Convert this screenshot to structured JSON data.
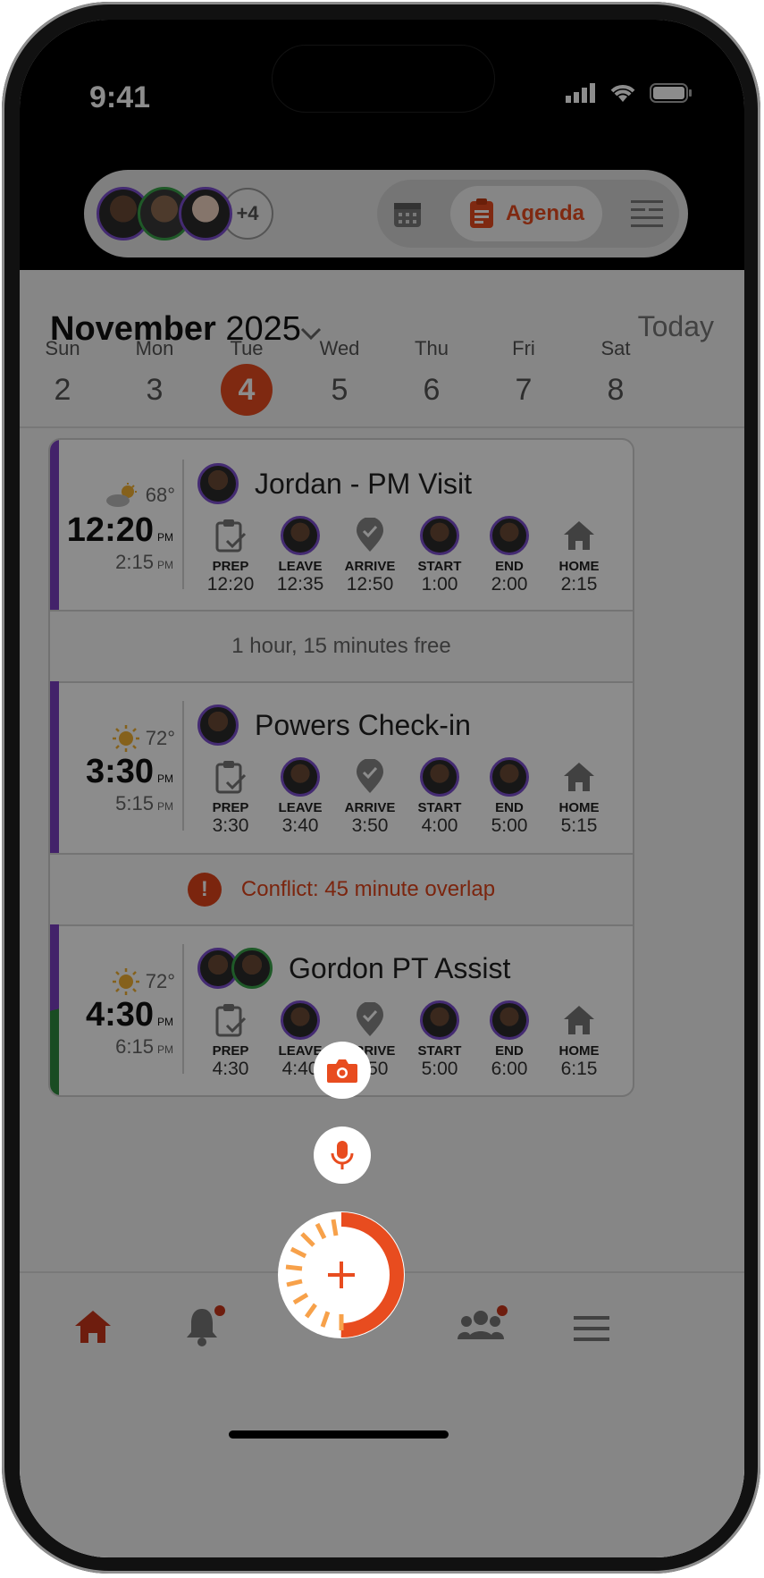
{
  "status": {
    "time": "9:41"
  },
  "header": {
    "more_count": "+4",
    "agenda_label": "Agenda"
  },
  "month": {
    "name": "November",
    "year": "2025",
    "today_label": "Today"
  },
  "week": [
    {
      "dow": "Sun",
      "date": "2"
    },
    {
      "dow": "Mon",
      "date": "3"
    },
    {
      "dow": "Tue",
      "date": "4",
      "selected": true
    },
    {
      "dow": "Wed",
      "date": "5"
    },
    {
      "dow": "Thu",
      "date": "6"
    },
    {
      "dow": "Fri",
      "date": "7"
    },
    {
      "dow": "Sat",
      "date": "8"
    }
  ],
  "events": [
    {
      "title": "Jordan - PM Visit",
      "temp": "68°",
      "weather": "partly-cloudy-icon",
      "start": "12:20",
      "start_ampm": "PM",
      "end": "2:15",
      "end_ampm": "PM",
      "steps": [
        {
          "label": "PREP",
          "time": "12:20"
        },
        {
          "label": "LEAVE",
          "time": "12:35"
        },
        {
          "label": "ARRIVE",
          "time": "12:50"
        },
        {
          "label": "START",
          "time": "1:00"
        },
        {
          "label": "END",
          "time": "2:00"
        },
        {
          "label": "HOME",
          "time": "2:15"
        }
      ]
    },
    {
      "title": "Powers Check-in",
      "temp": "72°",
      "weather": "sunny-icon",
      "start": "3:30",
      "start_ampm": "PM",
      "end": "5:15",
      "end_ampm": "PM",
      "steps": [
        {
          "label": "PREP",
          "time": "3:30"
        },
        {
          "label": "LEAVE",
          "time": "3:40"
        },
        {
          "label": "ARRIVE",
          "time": "3:50"
        },
        {
          "label": "START",
          "time": "4:00"
        },
        {
          "label": "END",
          "time": "5:00"
        },
        {
          "label": "HOME",
          "time": "5:15"
        }
      ]
    },
    {
      "title": "Gordon PT Assist",
      "temp": "72°",
      "weather": "sunny-icon",
      "start": "4:30",
      "start_ampm": "PM",
      "end": "6:15",
      "end_ampm": "PM",
      "steps": [
        {
          "label": "PREP",
          "time": "4:30"
        },
        {
          "label": "LEAVE",
          "time": "4:40"
        },
        {
          "label": "ARRIVE",
          "time": "4:50"
        },
        {
          "label": "START",
          "time": "5:00"
        },
        {
          "label": "END",
          "time": "6:00"
        },
        {
          "label": "HOME",
          "time": "6:15"
        }
      ]
    }
  ],
  "gaps": {
    "free_text": "1 hour, 15 minutes free",
    "conflict_text": "Conflict: 45 minute overlap"
  },
  "colors": {
    "accent": "#e84c1f",
    "purple": "#7a3fc1",
    "green": "#2f8a3e"
  }
}
